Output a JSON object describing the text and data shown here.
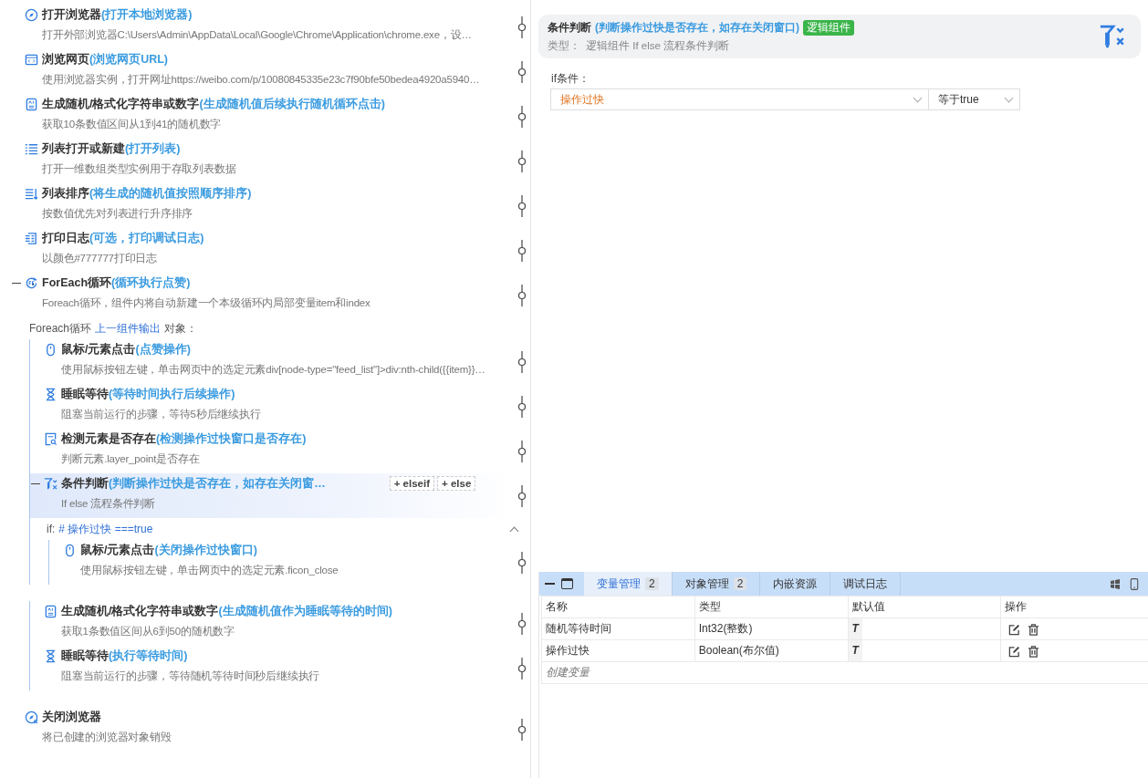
{
  "flow": {
    "steps": [
      {
        "kind": "browser",
        "title": "打开浏览器",
        "note": "(打开本地浏览器)",
        "desc": "打开外部浏览器C:\\Users\\Admin\\AppData\\Local\\Google\\Chrome\\Application\\chrome.exe，设…",
        "selected": false
      },
      {
        "kind": "webpage",
        "title": "浏览网页",
        "note": "(浏览网页URL)",
        "desc": "使用浏览器实例，打开网址https://weibo.com/p/10080845335e23c7f90bfe50bedea4920a5940…",
        "selected": false
      },
      {
        "kind": "random",
        "title": "生成随机/格式化字符串或数字",
        "note": "(生成随机值后续执行随机循环点击)",
        "desc": "获取10条数值区间从1到41的随机数字",
        "selected": false
      },
      {
        "kind": "list",
        "title": "列表打开或新建",
        "note": "(打开列表)",
        "desc": "打开一维数组类型实例用于存取列表数据",
        "selected": false
      },
      {
        "kind": "sort",
        "title": "列表排序",
        "note": "(将生成的随机值按照顺序排序)",
        "desc": "按数值优先对列表进行升序排序",
        "selected": false
      },
      {
        "kind": "log",
        "title": "打印日志",
        "note": "(可选，打印调试日志)",
        "desc": "以颜色#777777打印日志",
        "selected": false
      },
      {
        "kind": "foreach",
        "title": "ForEach循环",
        "note": " (循环执行点赞)",
        "desc": "Foreach循环，组件内将自动新建一个本级循环内局部变量item和index",
        "selected": false,
        "expanded": true,
        "loop": {
          "prefix": "Foreach循环",
          "link": "上一组件输出",
          "suffix": "对象："
        },
        "children": [
          {
            "kind": "mouse",
            "title": "鼠标/元素点击",
            "note": "(点赞操作)",
            "desc": "使用鼠标按钮左键，单击网页中的选定元素div[node-type=\"feed_list\"]>div:nth-child({{item}}…",
            "selected": false
          },
          {
            "kind": "sleep",
            "title": "睡眠等待",
            "note": "(等待时间执行后续操作)",
            "desc": "阻塞当前运行的步骤，等待5秒后继续执行",
            "selected": false
          },
          {
            "kind": "detect",
            "title": "检测元素是否存在",
            "note": "(检测操作过快窗口是否存在)",
            "desc": "判断元素.layer_point是否存在",
            "selected": false
          },
          {
            "kind": "condition",
            "title": "条件判断",
            "note": "(判断操作过快是否存在，如存在关闭窗…",
            "desc": "If else 流程条件判断",
            "selected": true,
            "expanded": true,
            "actions": [
              "+ elseif",
              "+ else"
            ],
            "branches": [
              {
                "label": "if:",
                "condition": "# 操作过快 ===true",
                "expanded": true,
                "children": [
                  {
                    "kind": "mouse",
                    "title": "鼠标/元素点击",
                    "note": "(关闭操作过快窗口)",
                    "desc": "使用鼠标按钮左键，单击网页中的选定元素.ficon_close",
                    "selected": false
                  }
                ]
              }
            ]
          },
          {
            "kind": "random",
            "title": "生成随机/格式化字符串或数字",
            "note": "(生成随机值作为睡眠等待的时间)",
            "desc": "获取1条数值区间从6到50的随机数字",
            "selected": false
          },
          {
            "kind": "sleep",
            "title": "睡眠等待",
            "note": "(执行等待时间)",
            "desc": "阻塞当前运行的步骤，等待随机等待时间秒后继续执行",
            "selected": false
          }
        ]
      },
      {
        "kind": "close",
        "title": "关闭浏览器",
        "desc": "将已创建的浏览器对象销毁",
        "selected": false
      }
    ]
  },
  "detail": {
    "title": "条件判断",
    "note": "(判断操作过快是否存在，如存在关闭窗口)",
    "badge": "逻辑组件",
    "type_label": "类型：",
    "type_value": "逻辑组件 If else 流程条件判断",
    "if_label": "if条件：",
    "variable": "操作过快",
    "operator": "等于true"
  },
  "bottom_panel": {
    "tabs": [
      {
        "label": "变量管理",
        "count": "2",
        "selected": true
      },
      {
        "label": "对象管理",
        "count": "2",
        "selected": false
      },
      {
        "label": "内嵌资源",
        "selected": false
      },
      {
        "label": "调试日志",
        "selected": false
      }
    ],
    "columns": [
      "名称",
      "类型",
      "默认值",
      "操作"
    ],
    "rows": [
      {
        "name": "随机等待时间",
        "type": "Int32(整数)",
        "default": "T"
      },
      {
        "name": "操作过快",
        "type": "Boolean(布尔值)",
        "default": "T"
      }
    ],
    "create": "创建变量"
  }
}
